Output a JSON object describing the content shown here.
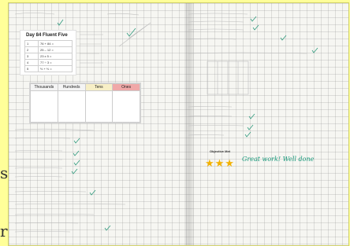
{
  "page": {
    "edge_chars": [
      "s",
      "r"
    ]
  },
  "fluent_five": {
    "title": "Day 84 Fluent Five",
    "rows": [
      {
        "n": "1",
        "q": "76 + 84 ="
      },
      {
        "n": "2",
        "q": "25 – 12 ="
      },
      {
        "n": "3",
        "q": "23 x 5 ="
      },
      {
        "n": "4",
        "q": "77 ÷ 3 ="
      },
      {
        "n": "5",
        "q": "⅔ + ⅓ ="
      }
    ]
  },
  "place_value": {
    "headers": [
      "Thousands",
      "Hundreds",
      "Tens",
      "Ones"
    ]
  },
  "objective": {
    "label": "Objective Met",
    "stars": "★★★",
    "stars_count": 3,
    "comment": "Great work! Well done"
  },
  "colors": {
    "frame": "#ffff99",
    "tens_header": "#f7efc6",
    "ones_header": "#f0a8a8",
    "tick": "#2f9a7d",
    "star": "#f2b100",
    "comment": "#1a9a7c"
  }
}
